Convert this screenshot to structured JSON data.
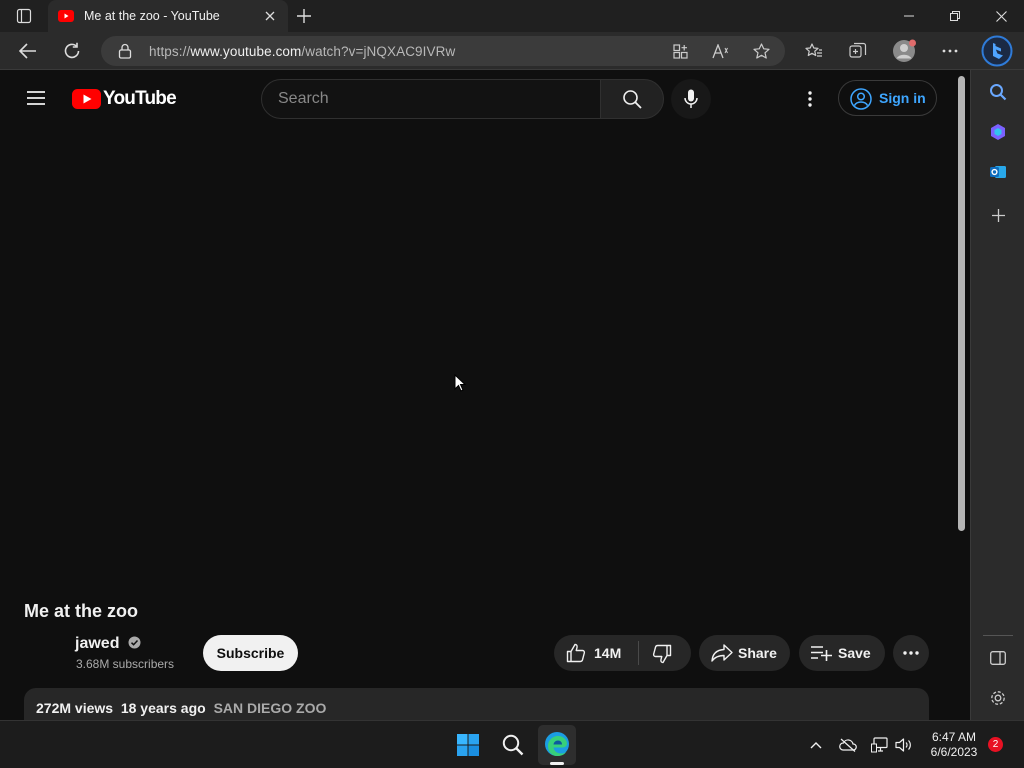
{
  "browser": {
    "tab_title": "Me at the zoo - YouTube",
    "url_prefix": "https://",
    "url_host": "www.youtube.com",
    "url_path": "/watch?v=jNQXAC9IVRw",
    "icons": [
      "tab-actions-icon",
      "youtube-favicon",
      "close-icon",
      "new-tab-icon",
      "minimize-icon",
      "restore-icon",
      "close-window-icon",
      "back-icon",
      "refresh-icon",
      "lock-icon",
      "app-available-icon",
      "read-aloud-icon",
      "favorite-star-icon",
      "favorites-icon",
      "collections-icon",
      "profile-avatar",
      "more-icon",
      "bing-chat-icon"
    ]
  },
  "youtube": {
    "logo_text": "YouTube",
    "search_placeholder": "Search",
    "sign_in_label": "Sign in",
    "video_title": "Me at the zoo",
    "channel_name": "jawed",
    "subscribers": "3.68M subscribers",
    "subscribe_label": "Subscribe",
    "likes": "14M",
    "share_label": "Share",
    "save_label": "Save",
    "views": "272M views",
    "age": "18 years ago",
    "tag": "SAN DIEGO ZOO"
  },
  "edge_sidebar": {
    "icons": [
      "search-icon",
      "copilot-icon",
      "outlook-icon",
      "add-icon",
      "sidebar-toggle-icon",
      "settings-icon"
    ]
  },
  "taskbar": {
    "time": "6:47 AM",
    "date": "6/6/2023",
    "notification_count": "2"
  },
  "colors": {
    "accent_blue": "#3ea6ff",
    "youtube_red": "#ff0000",
    "background": "#0f0f0f"
  }
}
